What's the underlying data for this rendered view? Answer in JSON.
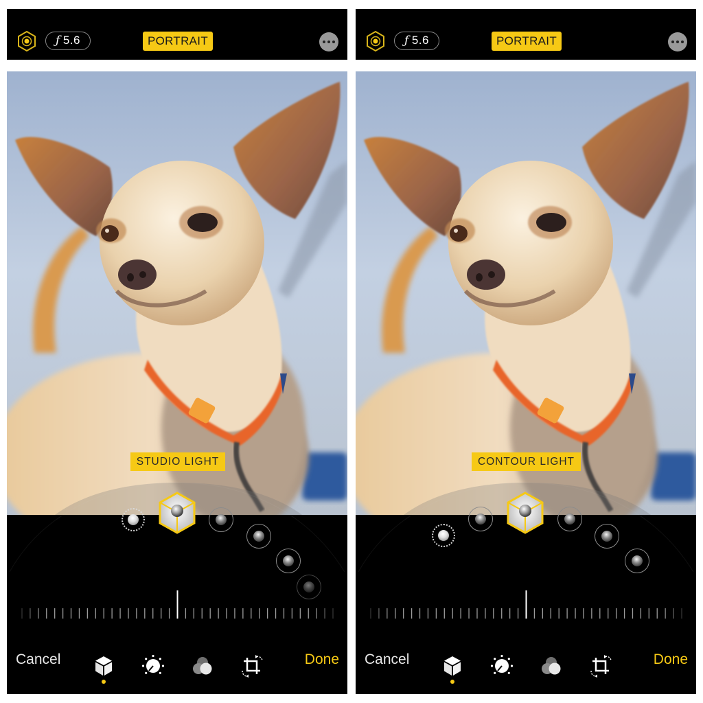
{
  "panels": [
    {
      "id": "left",
      "topbar": {
        "live_icon": "live-photo-hexagon-icon",
        "aperture_symbol": "ƒ",
        "aperture_value": "5.6",
        "mode_label": "PORTRAIT",
        "more_icon": "ellipsis-icon"
      },
      "lighting_effect_label": "STUDIO LIGHT",
      "selected_lighting_index": 1,
      "lighting_options": [
        {
          "name": "Natural Light",
          "style": "dots"
        },
        {
          "name": "Studio Light",
          "style": "cube"
        },
        {
          "name": "Contour Light",
          "style": "ring"
        },
        {
          "name": "Stage Light",
          "style": "ring"
        },
        {
          "name": "Stage Light Mono",
          "style": "ring"
        },
        {
          "name": "High-Key Light Mono",
          "style": "ring-faded"
        }
      ],
      "intensity_slider": {
        "value": 0.5,
        "tick_count": 39
      },
      "toolbar": {
        "cancel_label": "Cancel",
        "done_label": "Done",
        "tools": [
          {
            "name": "portrait-lighting",
            "icon": "cube-icon",
            "active": true
          },
          {
            "name": "adjust",
            "icon": "adjust-dial-icon",
            "active": false
          },
          {
            "name": "filters",
            "icon": "filters-circles-icon",
            "active": false
          },
          {
            "name": "crop",
            "icon": "crop-rotate-icon",
            "active": false
          }
        ]
      }
    },
    {
      "id": "right",
      "topbar": {
        "live_icon": "live-photo-hexagon-icon",
        "aperture_symbol": "ƒ",
        "aperture_value": "5.6",
        "mode_label": "PORTRAIT",
        "more_icon": "ellipsis-icon"
      },
      "lighting_effect_label": "CONTOUR LIGHT",
      "selected_lighting_index": 2,
      "lighting_options": [
        {
          "name": "Natural Light",
          "style": "dots"
        },
        {
          "name": "Studio Light",
          "style": "ring"
        },
        {
          "name": "Contour Light",
          "style": "cube"
        },
        {
          "name": "Stage Light",
          "style": "ring"
        },
        {
          "name": "Stage Light Mono",
          "style": "ring"
        },
        {
          "name": "High-Key Light Mono",
          "style": "ring"
        }
      ],
      "intensity_slider": {
        "value": 0.5,
        "tick_count": 39
      },
      "toolbar": {
        "cancel_label": "Cancel",
        "done_label": "Done",
        "tools": [
          {
            "name": "portrait-lighting",
            "icon": "cube-icon",
            "active": true
          },
          {
            "name": "adjust",
            "icon": "adjust-dial-icon",
            "active": false
          },
          {
            "name": "filters",
            "icon": "filters-circles-icon",
            "active": false
          },
          {
            "name": "crop",
            "icon": "crop-rotate-icon",
            "active": false
          }
        ]
      }
    }
  ],
  "colors": {
    "accent_yellow": "#f6c915",
    "bar_background": "#000000",
    "sky": "#b4c4dc",
    "dog_fur": "#e9d3b2",
    "collar": "#e8652a"
  }
}
